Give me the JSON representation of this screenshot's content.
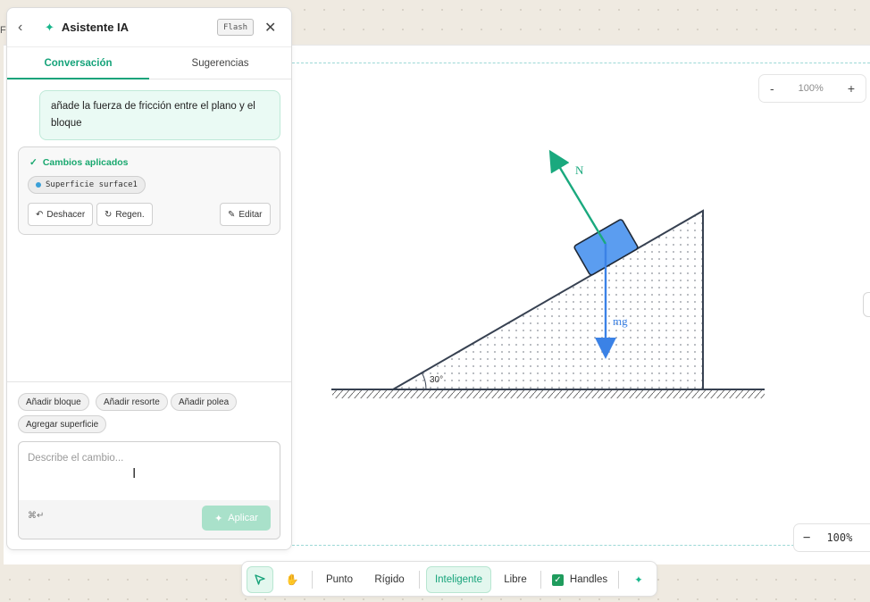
{
  "panel": {
    "title": "Asistente IA",
    "model_badge": "Flash",
    "tabs": [
      {
        "label": "Conversación",
        "active": true
      },
      {
        "label": "Sugerencias",
        "active": false
      }
    ],
    "user_message": "añade la fuerza de fricción entre el plano y el bloque",
    "result": {
      "status": "Cambios aplicados",
      "chip": "Superficie surface1",
      "buttons": {
        "undo": "Deshacer",
        "regen": "Regen.",
        "edit": "Editar"
      }
    },
    "suggestions": [
      "Añadir bloque",
      "Añadir resorte",
      "Añadir polea",
      "Agregar superficie"
    ],
    "composer": {
      "placeholder": "Describe el cambio...",
      "shortcut": "⌘↵",
      "apply_label": "Aplicar"
    }
  },
  "canvas": {
    "zoom_top": {
      "minus": "-",
      "value": "100%",
      "plus": "+"
    },
    "zoom_bottom": {
      "minus": "−",
      "value": "100%"
    },
    "diagram": {
      "angle_label": "30°",
      "normal_label": "N",
      "weight_label": "mg",
      "colors": {
        "block": "#5b9df0",
        "normal": "#1aa97e",
        "weight": "#3b82e6",
        "incline": "#374151"
      }
    }
  },
  "toolbar": {
    "modes": [
      "Punto",
      "Rígido",
      "Inteligente",
      "Libre"
    ],
    "active_mode": "Inteligente",
    "handles_label": "Handles",
    "handles_checked": true
  },
  "left_stub": "F"
}
